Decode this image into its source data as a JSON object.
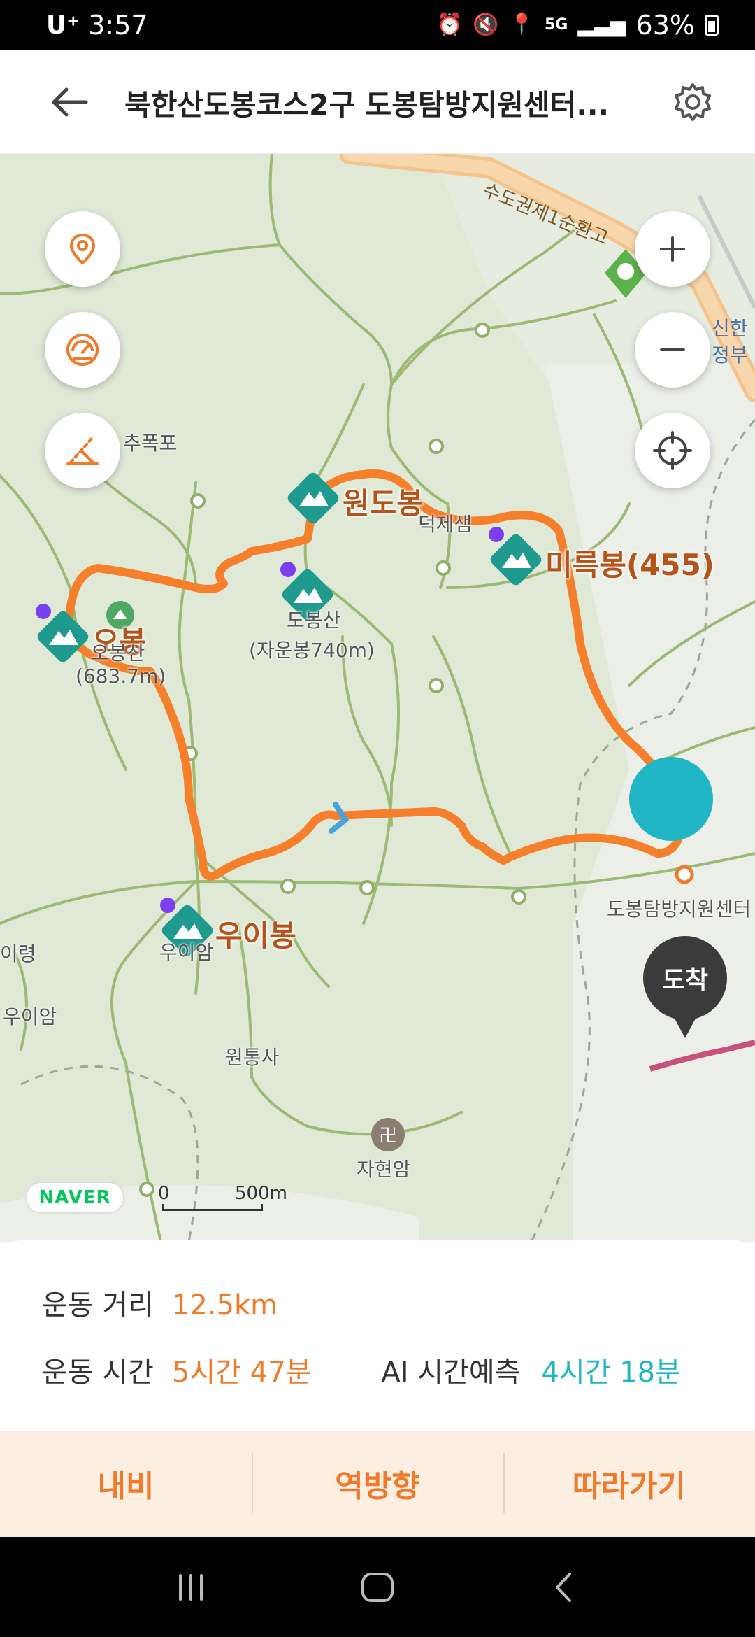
{
  "status_bar": {
    "carrier": "U⁺",
    "time": "3:57",
    "network": "5G",
    "battery": "63%"
  },
  "header": {
    "title": "북한산도봉코스2구 도봉탐방지원센터..."
  },
  "map": {
    "road_label": "수도권제1순환고",
    "peaks": {
      "wondobong": "원도봉",
      "mireukbong": "미륵봉(455)",
      "obong": "오봉",
      "uibong": "우이봉"
    },
    "labels": {
      "dobongsan": "도봉산",
      "jaunbong": "(자운봉740m)",
      "obong_sub": "오봉산",
      "obong_height": "(683.7m)",
      "deokjesaem": "덕제샘",
      "chupokpo": "추폭포",
      "uiam_small": "우이암",
      "uiam_left": "우이암",
      "uiryeong": "이령",
      "wontongsa": "원통사",
      "jahyeonam": "자현암",
      "dobong_center": "도봉탐방지원센터",
      "shinhan_1": "신한",
      "shinhan_2": "정부"
    },
    "arrive_label": "도착",
    "naver_logo": "NAVER",
    "scale_zero": "0",
    "scale_len": "500m"
  },
  "info": {
    "distance_label": "운동 거리",
    "distance_value": "12.5km",
    "time_label": "운동 시간",
    "time_value": "5시간 47분",
    "ai_label": "AI 시간예측",
    "ai_value": "4시간 18분"
  },
  "actions": {
    "navi": "내비",
    "reverse": "역방향",
    "follow": "따라가기"
  },
  "colors": {
    "route": "#f57f2a",
    "accent_orange": "#f07a2a",
    "accent_teal": "#1fb5c4",
    "peak_marker": "#1f9a8e"
  },
  "icons": [
    "back-arrow-icon",
    "gear-icon",
    "location-pin-icon",
    "speedometer-icon",
    "slope-icon",
    "zoom-in-icon",
    "zoom-out-icon",
    "crosshair-icon"
  ]
}
